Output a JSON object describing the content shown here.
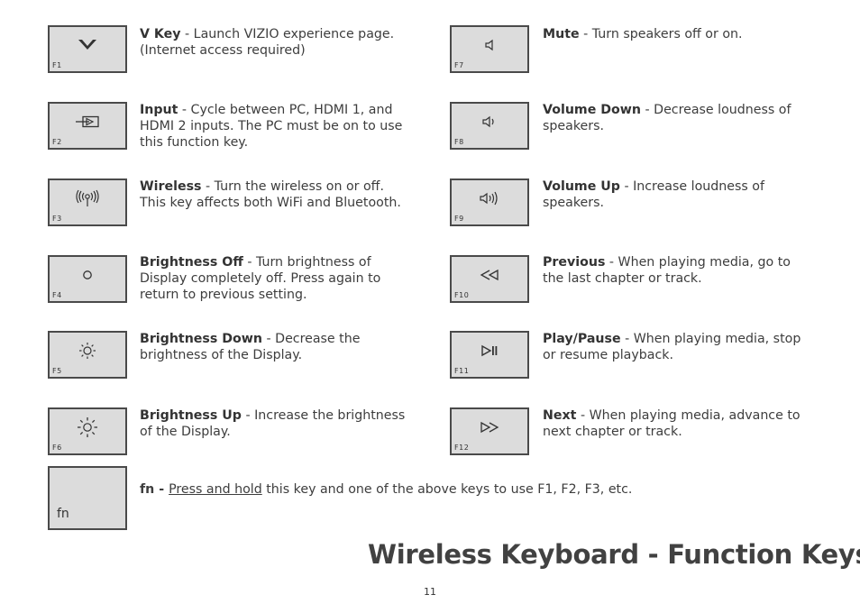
{
  "keys_left": [
    {
      "fkey": "F1",
      "icon": "vizio-v-icon",
      "name": "V Key",
      "desc": " - Launch VIZIO experience page. (Internet access required)"
    },
    {
      "fkey": "F2",
      "icon": "input-icon",
      "name": "Input",
      "desc": " - Cycle between PC, HDMI 1, and HDMI 2 inputs. The PC must be on to use this function key."
    },
    {
      "fkey": "F3",
      "icon": "wireless-icon",
      "name": "Wireless",
      "desc": " - Turn the wireless on or off. This key affects both WiFi and Bluetooth."
    },
    {
      "fkey": "F4",
      "icon": "brightness-off-icon",
      "name": "Brightness Off",
      "desc": " - Turn brightness of Display completely off. Press again to return to previous setting."
    },
    {
      "fkey": "F5",
      "icon": "brightness-down-icon",
      "name": "Brightness Down",
      "desc": " - Decrease the brightness of the Display."
    },
    {
      "fkey": "F6",
      "icon": "brightness-up-icon",
      "name": "Brightness Up",
      "desc": " - Increase the brightness of the Display."
    }
  ],
  "keys_right": [
    {
      "fkey": "F7",
      "icon": "mute-icon",
      "name": "Mute",
      "desc": " - Turn speakers off or on."
    },
    {
      "fkey": "F8",
      "icon": "volume-down-icon",
      "name": "Volume Down",
      "desc": " - Decrease loudness of speakers."
    },
    {
      "fkey": "F9",
      "icon": "volume-up-icon",
      "name": "Volume Up",
      "desc": " - Increase loudness of speakers."
    },
    {
      "fkey": "F10",
      "icon": "previous-icon",
      "name": "Previous",
      "desc": " - When playing media, go to the last chapter or track."
    },
    {
      "fkey": "F11",
      "icon": "play-pause-icon",
      "name": "Play/Pause",
      "desc": " - When playing media, stop or resume playback."
    },
    {
      "fkey": "F12",
      "icon": "next-icon",
      "name": "Next",
      "desc": " - When playing media, advance to next chapter or track."
    }
  ],
  "fn": {
    "key_label": "fn",
    "name": "fn",
    "dash": " - ",
    "emphasis": "Press and hold",
    "rest": " this key and one of the above keys to use F1, F2, F3, etc."
  },
  "title": "Wireless Keyboard - Function Keys",
  "page_number": "11"
}
